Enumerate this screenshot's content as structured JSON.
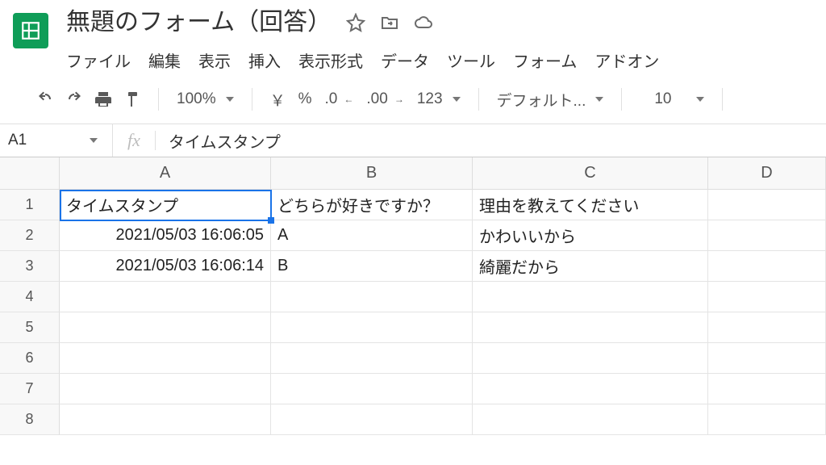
{
  "header": {
    "doc_title": "無題のフォーム（回答）"
  },
  "menu": {
    "file": "ファイル",
    "edit": "編集",
    "view": "表示",
    "insert": "挿入",
    "format": "表示形式",
    "data": "データ",
    "tools": "ツール",
    "form": "フォーム",
    "addons": "アドオン"
  },
  "toolbar": {
    "zoom": "100%",
    "currency": "￥",
    "percent": "%",
    "dec_dec": ".0",
    "inc_dec": ".00",
    "num_fmt": "123",
    "font": "デフォルト...",
    "font_size": "10"
  },
  "name_box": "A1",
  "formula_bar_value": "タイムスタンプ",
  "columns": {
    "A": "A",
    "B": "B",
    "C": "C",
    "D": "D"
  },
  "rows": [
    "1",
    "2",
    "3",
    "4",
    "5",
    "6",
    "7",
    "8"
  ],
  "sheet": {
    "headers": {
      "A": "タイムスタンプ",
      "B": "どちらが好きですか？",
      "C": "理由を教えてください"
    },
    "data": [
      {
        "A": "2021/05/03 16:06:05",
        "B": "A",
        "C": "かわいいから"
      },
      {
        "A": "2021/05/03 16:06:14",
        "B": "B",
        "C": "綺麗だから"
      }
    ]
  }
}
